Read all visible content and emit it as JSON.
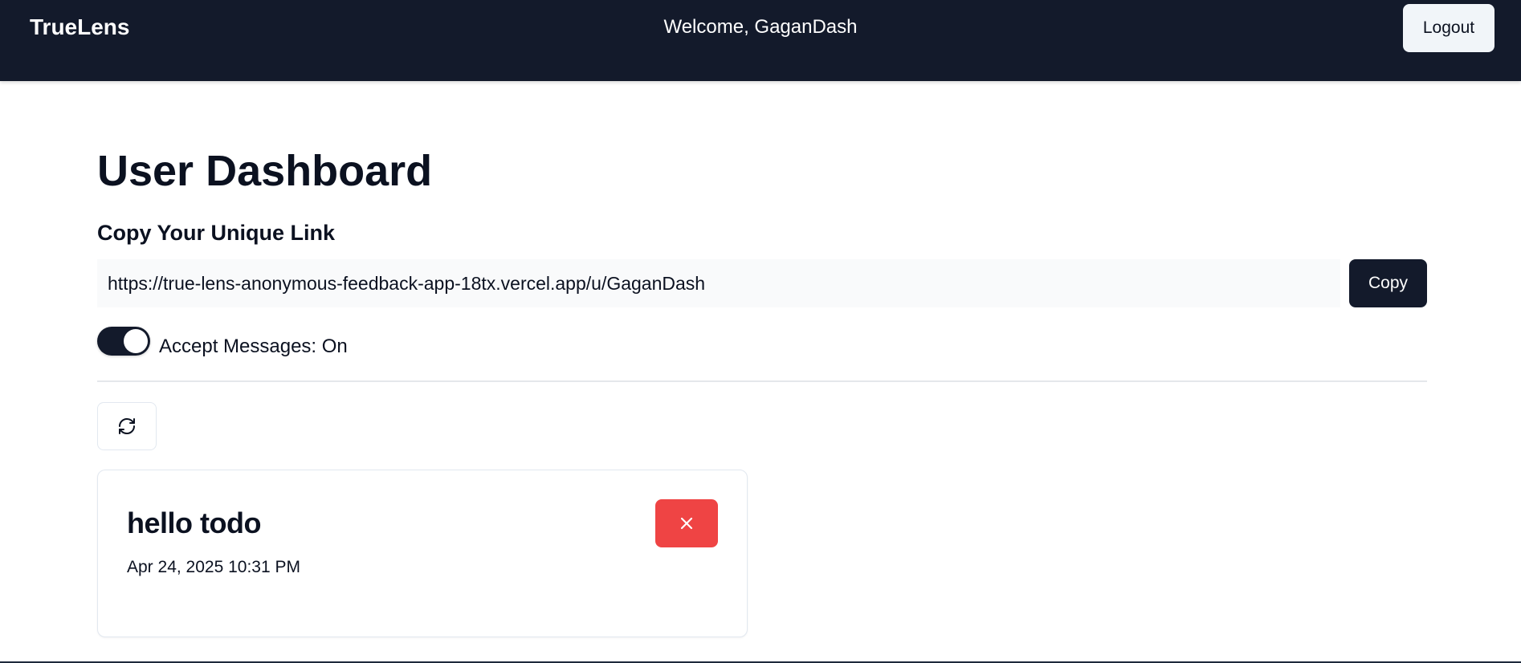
{
  "navbar": {
    "brand": "TrueLens",
    "welcome": "Welcome, GaganDash",
    "logout_label": "Logout",
    "background_color": "#131a2b"
  },
  "main": {
    "title": "User Dashboard",
    "link_section": {
      "heading": "Copy Your Unique Link",
      "url": "https://true-lens-anonymous-feedback-app-18tx.vercel.app/u/GaganDash",
      "copy_label": "Copy"
    },
    "accept_messages": {
      "label": "Accept Messages: On",
      "enabled": true
    },
    "refresh": {
      "icon": "refresh-icon"
    },
    "messages": [
      {
        "content": "hello todo",
        "date": "Apr 24, 2025 10:31 PM",
        "delete_icon": "close-icon",
        "delete_color": "#ef4444"
      }
    ]
  }
}
